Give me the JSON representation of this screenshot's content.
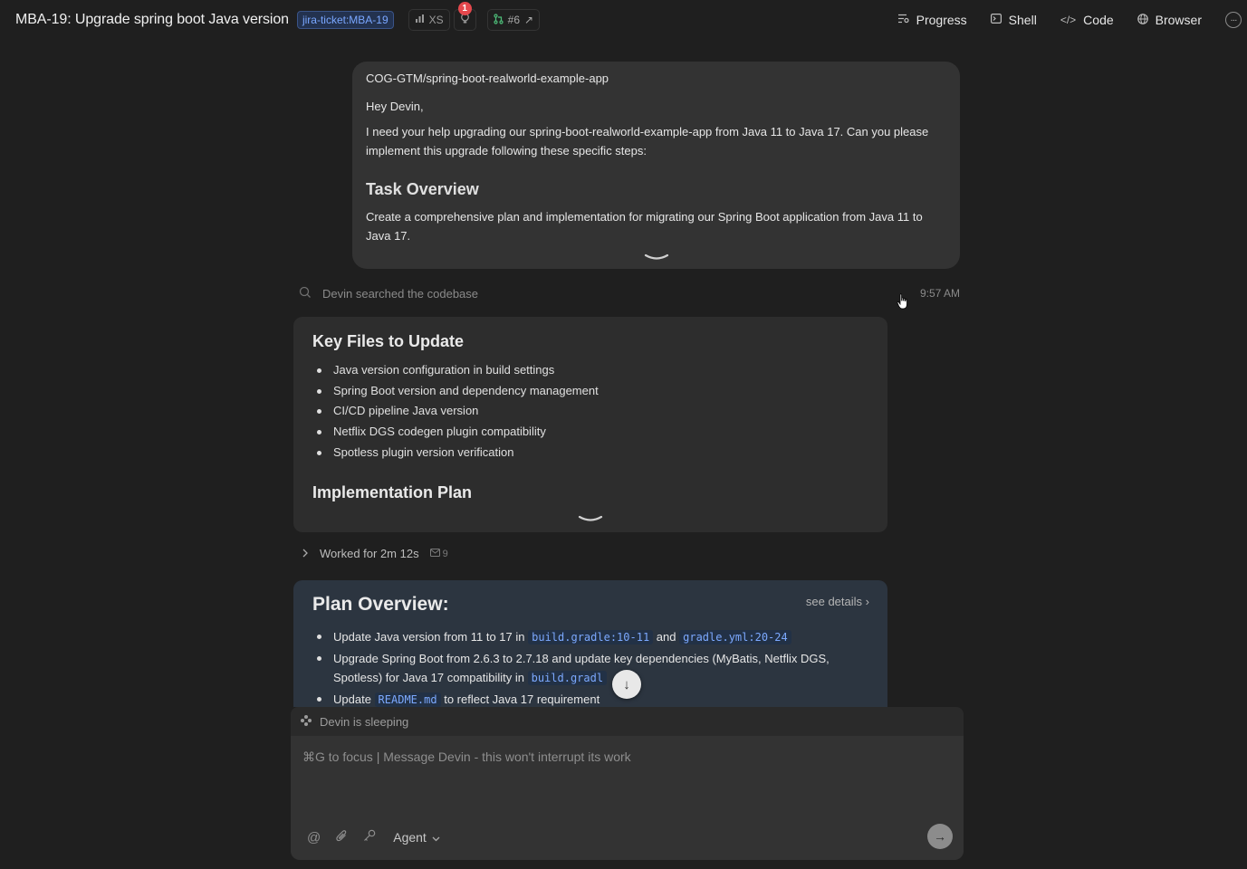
{
  "header": {
    "title": "MBA-19: Upgrade spring boot Java version",
    "jira_tag": "jira-ticket:MBA-19",
    "size_label": "XS",
    "notification_count": "1",
    "pr_label": "#6",
    "nav": {
      "progress": "Progress",
      "shell": "Shell",
      "code": "Code",
      "browser": "Browser"
    }
  },
  "message": {
    "repo": "COG-GTM/spring-boot-realworld-example-app",
    "greeting": "Hey Devin,",
    "body": "I need your help upgrading our spring-boot-realworld-example-app from Java 11 to Java 17. Can you please implement this upgrade following these specific steps:",
    "heading": "Task Overview",
    "overview": "Create a comprehensive plan and implementation for migrating our Spring Boot application from Java 11 to Java 17."
  },
  "search": {
    "text": "Devin searched the codebase",
    "time": "9:57 AM"
  },
  "key_files": {
    "heading": "Key Files to Update",
    "items": [
      "Java version configuration in build settings",
      "Spring Boot version and dependency management",
      "CI/CD pipeline Java version",
      "Netflix DGS codegen plugin compatibility",
      "Spotless plugin version verification"
    ],
    "next_heading": "Implementation Plan"
  },
  "worked": {
    "text": "Worked for 2m 12s",
    "count": "9"
  },
  "plan": {
    "heading": "Plan Overview:",
    "details_link": "see details",
    "item1": {
      "pre": "Update Java version from 11 to 17 in",
      "code1": "build.gradle:10-11",
      "mid": "and",
      "code2": "gradle.yml:20-24"
    },
    "item2": {
      "pre": "Upgrade Spring Boot from 2.6.3 to 2.7.18 and update key dependencies (MyBatis, Netflix DGS, Spotless) for Java 17 compatibility in",
      "code": "build.gradl"
    },
    "item3": {
      "pre": "Update",
      "code": "README.md",
      "post": "to reflect Java 17 requirement"
    }
  },
  "composer": {
    "status": "Devin is sleeping",
    "placeholder": "⌘G to focus | Message Devin - this won't interrupt its work",
    "agent_label": "Agent"
  },
  "colors": {
    "background": "#1f1f1f",
    "bubble": "#333333",
    "plan_card": "#2c3540",
    "code_text": "#7ca9ff",
    "badge": "#e5484d",
    "branch": "#4ec07a"
  }
}
